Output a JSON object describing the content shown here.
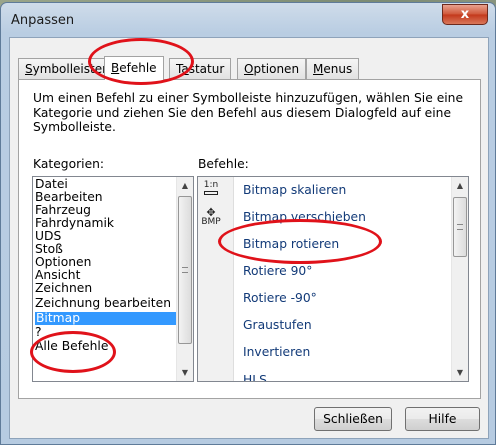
{
  "window": {
    "title": "Anpassen",
    "close_glyph": "x"
  },
  "tabs": [
    {
      "label": "Symbolleisten",
      "ul": "S",
      "rest": "ymbolleisten",
      "active": false
    },
    {
      "label": "Befehle",
      "ul": "B",
      "rest": "efehle",
      "active": true
    },
    {
      "label": "Tastatur",
      "pre": "T",
      "ul": "a",
      "rest": "statur",
      "active": false
    },
    {
      "label": "Optionen",
      "ul": "O",
      "rest": "ptionen",
      "active": false
    },
    {
      "label": "Menus",
      "ul": "M",
      "rest": "enus",
      "active": false
    }
  ],
  "instruction": "Um einen Befehl zu einer Symbolleiste hinzuzufügen, wählen Sie eine Kategorie und ziehen Sie den Befehl aus diesem Dialogfeld auf eine Symbolleiste.",
  "categories": {
    "label": "Kategorien:",
    "items": [
      "Datei",
      "Bearbeiten",
      "Fahrzeug",
      "Fahrdynamik",
      "UDS",
      "Stoß",
      "Optionen",
      "Ansicht",
      "Zeichnen",
      "Zeichnung bearbeiten",
      "Bitmap",
      "?",
      "Alle Befehle"
    ],
    "selected": "Bitmap"
  },
  "commands": {
    "label": "Befehle:",
    "items": [
      {
        "label": "Bitmap skalieren",
        "icon": "scale-bitmap-icon",
        "icon_text": "1:n"
      },
      {
        "label": "Bitmap verschieben",
        "icon": "move-bitmap-icon",
        "icon_text": "BMP"
      },
      {
        "label": "Bitmap rotieren",
        "icon": "",
        "icon_text": ""
      },
      {
        "label": "Rotiere  90°",
        "icon": "",
        "icon_text": ""
      },
      {
        "label": "Rotiere  -90°",
        "icon": "",
        "icon_text": ""
      },
      {
        "label": "Graustufen",
        "icon": "",
        "icon_text": ""
      },
      {
        "label": "Invertieren",
        "icon": "",
        "icon_text": ""
      },
      {
        "label": "HLS",
        "icon": "",
        "icon_text": ""
      }
    ]
  },
  "buttons": {
    "close": "Schließen",
    "help": "Hilfe"
  },
  "colors": {
    "selection": "#3399ff",
    "annotation": "#e0121a",
    "command_text": "#123a78"
  }
}
